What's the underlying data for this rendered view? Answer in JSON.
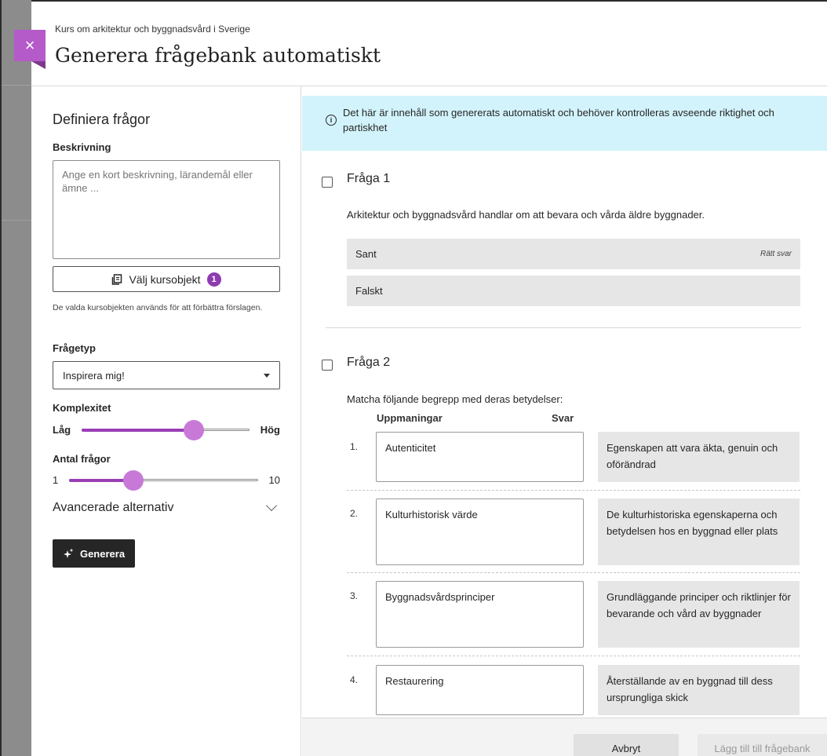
{
  "header": {
    "course_name": "Kurs om arkitektur och byggnadsvård i Sverige",
    "title": "Generera frågebank automatiskt",
    "close_glyph": "×"
  },
  "left": {
    "heading": "Definiera frågor",
    "description_label": "Beskrivning",
    "description_placeholder": "Ange en kort beskrivning, lärandemål eller ämne ...",
    "select_objects_label": "Välj kursobjekt",
    "select_objects_count": "1",
    "helper_text": "De valda kursobjekten används för att förbättra förslagen.",
    "question_type_label": "Frågetyp",
    "question_type_value": "Inspirera mig!",
    "complexity_label": "Komplexitet",
    "complexity_low": "Låg",
    "complexity_high": "Hög",
    "complexity_value_fraction": 0.67,
    "count_label": "Antal frågor",
    "count_min": "1",
    "count_max": "10",
    "count_value_fraction": 0.34,
    "advanced_label": "Avancerade alternativ",
    "generate_label": "Generera"
  },
  "banner": {
    "text": "Det här är innehåll som genererats automatiskt och behöver kontrolleras avseende riktighet och partiskhet"
  },
  "question1": {
    "title": "Fråga 1",
    "text": "Arkitektur och byggnadsvård handlar om att bevara och vårda äldre byggnader.",
    "options": [
      {
        "label": "Sant",
        "tag": "Rätt svar"
      },
      {
        "label": "Falskt",
        "tag": ""
      }
    ]
  },
  "question2": {
    "title": "Fråga 2",
    "text": "Matcha följande begrepp med deras betydelser:",
    "col_prompts": "Uppmaningar",
    "col_answers": "Svar",
    "pairs": [
      {
        "num": "1.",
        "prompt": "Autenticitet",
        "answer": "Egenskapen att vara äkta, genuin och oförändrad"
      },
      {
        "num": "2.",
        "prompt": "Kulturhistorisk värde",
        "answer": "De kulturhistoriska egenskaperna och betydelsen hos en byggnad eller plats"
      },
      {
        "num": "3.",
        "prompt": "Byggnadsvårdsprinciper",
        "answer": "Grundläggande principer och riktlinjer för bevarande och vård av byggnader"
      },
      {
        "num": "4.",
        "prompt": "Restaurering",
        "answer": "Återställande av en byggnad till dess ursprungliga skick"
      }
    ]
  },
  "footer": {
    "cancel_label": "Avbryt",
    "add_label": "Lägg till till frågebank"
  },
  "colors": {
    "accent": "#9a3fb5",
    "close_tab": "#b55ac9",
    "banner_bg": "#d2f3fb",
    "primary_button": "#262626"
  }
}
